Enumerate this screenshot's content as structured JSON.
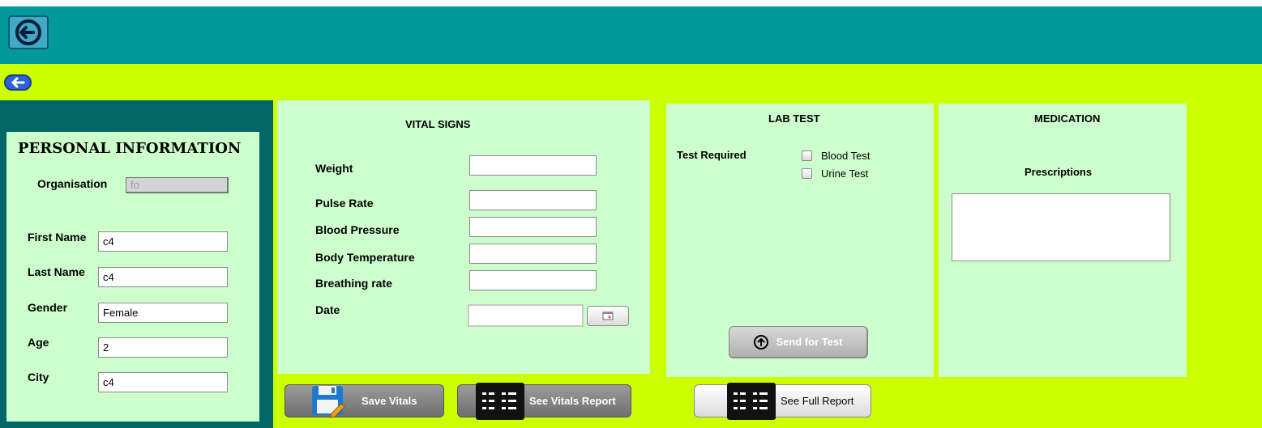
{
  "header": {
    "logout_icon": "logout-arrow-icon",
    "back_icon": "back-arrow-icon"
  },
  "personal": {
    "title": "PERSONAL INFORMATION",
    "organisation_label": "Organisation",
    "organisation_value": "fo",
    "first_name_label": "First Name",
    "first_name_value": "c4",
    "last_name_label": "Last Name",
    "last_name_value": "c4",
    "gender_label": "Gender",
    "gender_value": "Female",
    "age_label": "Age",
    "age_value": "2",
    "city_label": "City",
    "city_value": "c4"
  },
  "vitals": {
    "title": "VITAL SIGNS",
    "weight_label": "Weight",
    "pulse_label": "Pulse Rate",
    "bp_label": "Blood Pressure",
    "temp_label": "Body Temperature",
    "breathing_label": "Breathing rate",
    "date_label": "Date",
    "weight_value": "",
    "pulse_value": "",
    "bp_value": "",
    "temp_value": "",
    "breathing_value": "",
    "date_value": ""
  },
  "lab": {
    "title": "LAB TEST",
    "test_required_label": "Test Required",
    "blood_test": "Blood Test",
    "urine_test": "Urine Test",
    "send_label": "Send for Test"
  },
  "medication": {
    "title": "MEDICATION",
    "prescriptions_label": "Prescriptions",
    "prescriptions_value": ""
  },
  "actions": {
    "save_vitals": "Save Vitals",
    "see_vitals_report": "See Vitals  Report",
    "see_full_report": "See Full Report"
  },
  "colors": {
    "header": "#009999",
    "background": "#ccff00",
    "sidebar": "#006666",
    "panel": "#ccffcc"
  }
}
